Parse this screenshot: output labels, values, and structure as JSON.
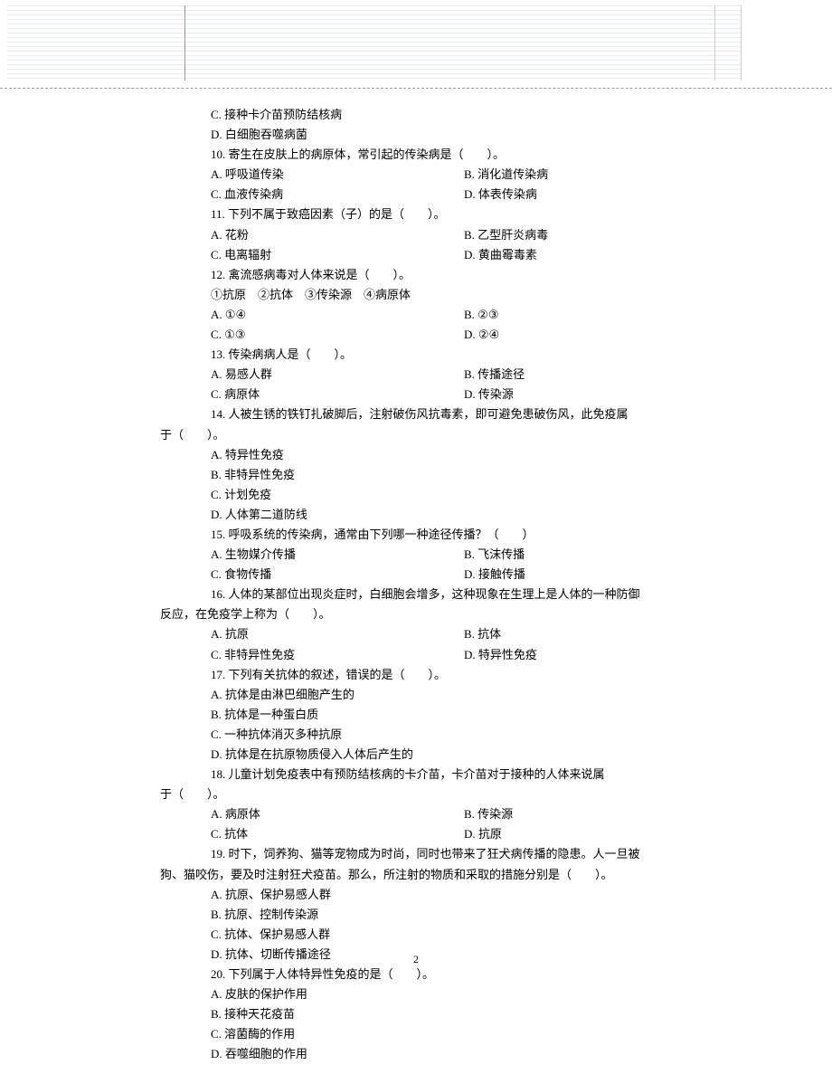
{
  "lines": [
    {
      "cls": "indent1",
      "a": "C. 接种卡介苗预防结核病"
    },
    {
      "cls": "indent1",
      "a": "D. 白细胞吞噬病菌"
    },
    {
      "cls": "indent1",
      "a": "10. 寄生在皮肤上的病原体，常引起的传染病是（　　）。"
    },
    {
      "cls": "indent1 two-col",
      "a": "A. 呼吸道传染",
      "b": "B. 消化道传染病"
    },
    {
      "cls": "indent1 two-col",
      "a": "C. 血液传染病",
      "b": "D. 体表传染病"
    },
    {
      "cls": "indent1",
      "a": "11. 下列不属于致癌因素（子）的是（　　）。"
    },
    {
      "cls": "indent1 two-col",
      "a": "A. 花粉",
      "b": "B. 乙型肝炎病毒"
    },
    {
      "cls": "indent1 two-col",
      "a": "C. 电离辐射",
      "b": "D. 黄曲霉毒素"
    },
    {
      "cls": "indent1",
      "a": "12. 禽流感病毒对人体来说是（　　）。"
    },
    {
      "cls": "indent1",
      "a": "①抗原　②抗体　③传染源　④病原体"
    },
    {
      "cls": "indent1 two-col",
      "a": "A. ①④",
      "b": "B. ②③"
    },
    {
      "cls": "indent1 two-col",
      "a": "C. ①③",
      "b": "D. ②④"
    },
    {
      "cls": "indent1",
      "a": "13. 传染病病人是（　　）。"
    },
    {
      "cls": "indent1 two-col",
      "a": "A. 易感人群",
      "b": "B. 传播途径"
    },
    {
      "cls": "indent1 two-col",
      "a": "C. 病原体",
      "b": "D. 传染源"
    },
    {
      "cls": "indent1",
      "a": "14. 人被生锈的铁钉扎破脚后，注射破伤风抗毒素，即可避免患破伤风，此免疫属"
    },
    {
      "cls": "indent-neg",
      "a": "于（　　）。"
    },
    {
      "cls": "indent1",
      "a": "A. 特异性免疫"
    },
    {
      "cls": "indent1",
      "a": "B. 非特异性免疫"
    },
    {
      "cls": "indent1",
      "a": "C. 计划免疫"
    },
    {
      "cls": "indent1",
      "a": "D. 人体第二道防线"
    },
    {
      "cls": "indent1",
      "a": "15. 呼吸系统的传染病，通常由下列哪一种途径传播？（　　）"
    },
    {
      "cls": "indent1 two-col",
      "a": "A. 生物媒介传播",
      "b": "B. 飞沫传播"
    },
    {
      "cls": "indent1 two-col",
      "a": "C. 食物传播",
      "b": "D. 接触传播"
    },
    {
      "cls": "indent1",
      "a": "16. 人体的某部位出现炎症时，白细胞会增多，这种现象在生理上是人体的一种防御"
    },
    {
      "cls": "indent-neg",
      "a": "反应，在免疫学上称为（　　）。"
    },
    {
      "cls": "indent1 two-col",
      "a": "A. 抗原",
      "b": "B. 抗体"
    },
    {
      "cls": "indent1 two-col",
      "a": "C. 非特异性免疫",
      "b": "D. 特异性免疫"
    },
    {
      "cls": "indent1",
      "a": "17. 下列有关抗体的叙述，错误的是（　　）。"
    },
    {
      "cls": "indent1",
      "a": "A. 抗体是由淋巴细胞产生的"
    },
    {
      "cls": "indent1",
      "a": "B. 抗体是一种蛋白质"
    },
    {
      "cls": "indent1",
      "a": "C. 一种抗体消灭多种抗原"
    },
    {
      "cls": "indent1",
      "a": "D. 抗体是在抗原物质侵入人体后产生的"
    },
    {
      "cls": "indent1",
      "a": "18. 儿童计划免疫表中有预防结核病的卡介苗，卡介苗对于接种的人体来说属"
    },
    {
      "cls": "indent-neg",
      "a": "于（　　）。"
    },
    {
      "cls": "indent1 two-col",
      "a": "A. 病原体",
      "b": "B. 传染源"
    },
    {
      "cls": "indent1 two-col",
      "a": "C. 抗体",
      "b": "D. 抗原"
    },
    {
      "cls": "indent1",
      "a": "19. 时下，饲养狗、猫等宠物成为时尚，同时也带来了狂犬病传播的隐患。人一旦被"
    },
    {
      "cls": "indent-neg",
      "a": "狗、猫咬伤，要及时注射狂犬疫苗。那么，所注射的物质和采取的措施分别是（　　）。"
    },
    {
      "cls": "indent1",
      "a": "A. 抗原、保护易感人群"
    },
    {
      "cls": "indent1",
      "a": "B. 抗原、控制传染源"
    },
    {
      "cls": "indent1",
      "a": "C. 抗体、保护易感人群"
    },
    {
      "cls": "indent1",
      "a": "D. 抗体、切断传播途径"
    },
    {
      "cls": "indent1",
      "a": "20. 下列属于人体特异性免疫的是（　　）。"
    },
    {
      "cls": "indent1",
      "a": "A. 皮肤的保护作用"
    },
    {
      "cls": "indent1",
      "a": "B. 接种天花疫苗"
    },
    {
      "cls": "indent1",
      "a": "C. 溶菌酶的作用"
    },
    {
      "cls": "indent1",
      "a": "D. 吞噬细胞的作用"
    }
  ],
  "page_number": "2"
}
